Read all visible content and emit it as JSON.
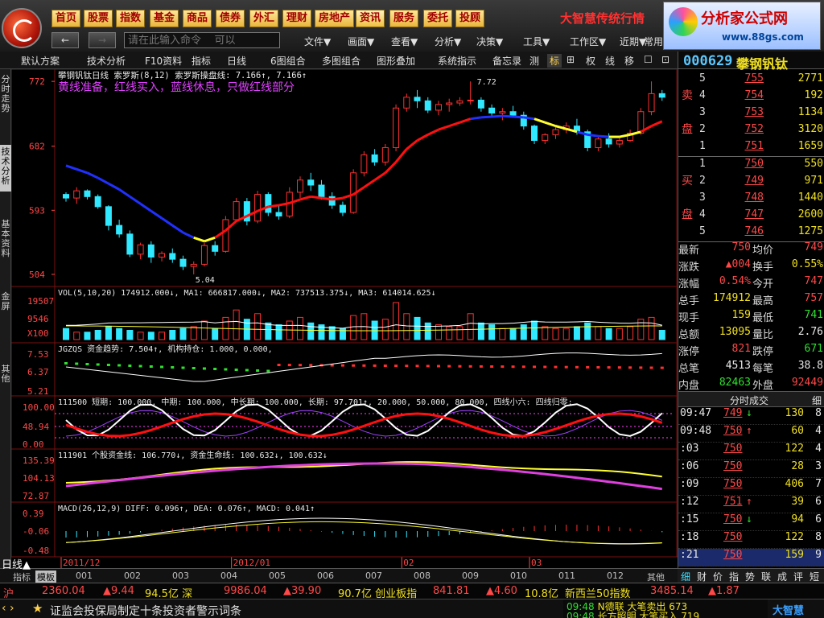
{
  "app": {
    "window_title": "大智慧",
    "menus": [
      "首页",
      "股票",
      "指数",
      "基金",
      "商品",
      "债券",
      "外汇",
      "理财",
      "房地产",
      "资讯",
      "服务",
      "委托",
      "投顾"
    ],
    "active_menu": "资讯",
    "brand_title": "大智慧传统行情",
    "brand_name": "分析家公式网",
    "brand_url": "www.88gs.com",
    "cmd_placeholder": "请在此输入命令    可以",
    "sub_menus": [
      "文件▼",
      "画面▼",
      "查看▼",
      "分析▼",
      "决策▼",
      "工具▼",
      "工作区▼",
      "近期▼",
      "常用"
    ]
  },
  "toolbar": {
    "items": [
      "默认方案",
      "技术分析",
      "F10资料",
      "指标",
      "日线",
      "6图组合",
      "多图组合",
      "图形叠加",
      "系统指示",
      "备忘录",
      "测",
      "标",
      "⊞",
      "权",
      "线",
      "移",
      "☐",
      "⊡"
    ],
    "selected": "标"
  },
  "left_tabs": [
    {
      "label": "分时走势",
      "selected": false
    },
    {
      "label": "技术分析",
      "selected": true
    },
    {
      "label": "基本资料",
      "selected": false
    },
    {
      "label": "金屏",
      "selected": false
    },
    {
      "label": "其他",
      "selected": false
    }
  ],
  "stock": {
    "code": "000629",
    "name": "攀钢钒钛"
  },
  "chart_data": {
    "type": "candlestick",
    "period": "日线",
    "header": "攀钢钒钛日线  索罗斯(8,12)  索罗斯操盘线: 7.166↑, 7.166↑",
    "annotation": "黄线准备，红线买入，蓝线休息，只做红线部分",
    "y_ticks": [
      "772",
      "682",
      "593",
      "504"
    ],
    "high_label": "7.72",
    "low_label": "5.04",
    "x_ticks": [
      "2011/12",
      "2012/01",
      "02",
      "03"
    ],
    "candles": [
      [
        6.15,
        6.18,
        6.05,
        6.1
      ],
      [
        6.1,
        6.25,
        6.02,
        6.2
      ],
      [
        6.2,
        6.22,
        6.08,
        6.12
      ],
      [
        6.12,
        6.15,
        5.95,
        5.98
      ],
      [
        5.98,
        6.0,
        5.65,
        5.72
      ],
      [
        5.72,
        5.8,
        5.55,
        5.6
      ],
      [
        5.6,
        5.65,
        5.28,
        5.32
      ],
      [
        5.32,
        5.48,
        5.25,
        5.45
      ],
      [
        5.45,
        5.5,
        5.2,
        5.28
      ],
      [
        5.28,
        5.36,
        5.22,
        5.33
      ],
      [
        5.33,
        5.4,
        5.2,
        5.25
      ],
      [
        5.25,
        5.3,
        5.1,
        5.15
      ],
      [
        5.15,
        5.22,
        5.04,
        5.18
      ],
      [
        5.18,
        5.48,
        5.15,
        5.44
      ],
      [
        5.44,
        5.5,
        5.3,
        5.36
      ],
      [
        5.36,
        5.85,
        5.34,
        5.8
      ],
      [
        5.8,
        6.1,
        5.78,
        6.05
      ],
      [
        6.05,
        6.1,
        5.72,
        5.78
      ],
      [
        5.78,
        6.2,
        5.75,
        6.15
      ],
      [
        6.15,
        6.18,
        5.85,
        5.9
      ],
      [
        5.9,
        6.0,
        5.8,
        5.85
      ],
      [
        5.85,
        6.25,
        5.82,
        6.18
      ],
      [
        6.18,
        6.4,
        6.1,
        6.35
      ],
      [
        6.35,
        6.45,
        6.2,
        6.28
      ],
      [
        6.28,
        6.35,
        6.08,
        6.12
      ],
      [
        6.12,
        6.18,
        5.95,
        6.0
      ],
      [
        6.0,
        6.05,
        5.85,
        5.9
      ],
      [
        5.9,
        6.5,
        5.88,
        6.45
      ],
      [
        6.45,
        6.75,
        6.4,
        6.7
      ],
      [
        6.7,
        6.78,
        6.55,
        6.6
      ],
      [
        6.6,
        6.85,
        6.55,
        6.8
      ],
      [
        6.8,
        7.4,
        6.75,
        7.35
      ],
      [
        7.35,
        7.55,
        7.3,
        7.5
      ],
      [
        7.5,
        7.6,
        7.35,
        7.45
      ],
      [
        7.45,
        7.5,
        7.28,
        7.32
      ],
      [
        7.32,
        7.45,
        7.25,
        7.4
      ],
      [
        7.4,
        7.48,
        7.3,
        7.42
      ],
      [
        7.42,
        7.5,
        7.38,
        7.45
      ],
      [
        7.45,
        7.72,
        7.4,
        7.46
      ],
      [
        7.46,
        7.5,
        7.3,
        7.35
      ],
      [
        7.35,
        7.4,
        7.22,
        7.28
      ],
      [
        7.28,
        7.35,
        7.18,
        7.3
      ],
      [
        7.3,
        7.38,
        7.22,
        7.25
      ],
      [
        7.25,
        7.3,
        7.05,
        7.1
      ],
      [
        7.1,
        7.12,
        6.85,
        6.9
      ],
      [
        6.9,
        7.0,
        6.85,
        6.98
      ],
      [
        6.98,
        7.1,
        6.92,
        7.05
      ],
      [
        7.05,
        7.15,
        7.0,
        7.1
      ],
      [
        7.1,
        7.2,
        6.98,
        7.02
      ],
      [
        7.02,
        7.05,
        6.75,
        6.8
      ],
      [
        6.8,
        6.95,
        6.75,
        6.92
      ],
      [
        6.92,
        7.0,
        6.8,
        6.85
      ],
      [
        6.85,
        6.95,
        6.8,
        6.9
      ],
      [
        6.9,
        7.05,
        6.88,
        7.0
      ],
      [
        7.0,
        7.35,
        6.98,
        7.3
      ],
      [
        7.3,
        7.72,
        7.25,
        7.55
      ],
      [
        7.55,
        7.6,
        7.45,
        7.5
      ]
    ],
    "soros_line": [
      6.55,
      6.5,
      6.45,
      6.38,
      6.3,
      6.22,
      6.12,
      6.02,
      5.92,
      5.82,
      5.72,
      5.62,
      5.55,
      5.5,
      5.55,
      5.65,
      5.78,
      5.85,
      5.92,
      5.98,
      6.0,
      6.03,
      6.08,
      6.12,
      6.1,
      6.08,
      6.1,
      6.15,
      6.25,
      6.35,
      6.45,
      6.6,
      6.78,
      6.9,
      6.98,
      7.05,
      7.1,
      7.15,
      7.2,
      7.22,
      7.23,
      7.24,
      7.23,
      7.22,
      7.2,
      7.15,
      7.1,
      7.06,
      7.02,
      6.98,
      6.96,
      6.95,
      6.95,
      6.98,
      7.02,
      7.1,
      7.166
    ],
    "soros_color": [
      "b",
      "b",
      "b",
      "b",
      "b",
      "b",
      "b",
      "b",
      "b",
      "b",
      "b",
      "b",
      "b",
      "y",
      "y",
      "r",
      "r",
      "r",
      "r",
      "r",
      "r",
      "r",
      "r",
      "r",
      "r",
      "r",
      "r",
      "r",
      "r",
      "r",
      "r",
      "r",
      "r",
      "r",
      "r",
      "r",
      "r",
      "r",
      "r",
      "b",
      "b",
      "b",
      "b",
      "b",
      "b",
      "y",
      "y",
      "y",
      "y",
      "b",
      "b",
      "b",
      "y",
      "y",
      "y",
      "r",
      "r"
    ],
    "volume": {
      "header": "VOL(5,10,20)  174912.000↓, MA1: 666817.000↓, MA2: 737513.375↓, MA3: 614014.625↓",
      "y_ticks": [
        "19507",
        "9546",
        "X100"
      ]
    },
    "jgzqs": {
      "header": "JGZQS  资金趋势: 7.504↑, 机构持仓: 1.000, 0.000,",
      "y_ticks": [
        "7.53",
        "6.37",
        "5.21"
      ]
    },
    "ind111500": {
      "header": "111500  短期: 100.000, 中期: 100.000, 中长期: 100.000, 长期: 97.701↑, 20.000, 50.000, 80.000, 四线小六: 四线归零:",
      "y_ticks": [
        "100.00",
        "48.94",
        "0.00"
      ]
    },
    "ind111901": {
      "header": "111901  个股资金线: 106.770↓, 资金生命线: 100.632↓, 100.632↓",
      "y_ticks": [
        "135.39",
        "104.13",
        "72.87"
      ]
    },
    "macd": {
      "header": "MACD(26,12,9)  DIFF: 0.096↑, DEA: 0.076↑, MACD: 0.041↑",
      "y_ticks": [
        "0.39",
        "-0.06",
        "-0.48"
      ]
    }
  },
  "quote": {
    "sell": [
      {
        "lv": "5",
        "price": "755",
        "vol": "2771"
      },
      {
        "lv": "4",
        "price": "754",
        "vol": "192"
      },
      {
        "lv": "3",
        "price": "753",
        "vol": "1134"
      },
      {
        "lv": "2",
        "price": "752",
        "vol": "3120"
      },
      {
        "lv": "1",
        "price": "751",
        "vol": "1659"
      }
    ],
    "buy": [
      {
        "lv": "1",
        "price": "750",
        "vol": "550"
      },
      {
        "lv": "2",
        "price": "749",
        "vol": "971"
      },
      {
        "lv": "3",
        "price": "748",
        "vol": "1440"
      },
      {
        "lv": "4",
        "price": "747",
        "vol": "2600"
      },
      {
        "lv": "5",
        "price": "746",
        "vol": "1275"
      }
    ],
    "sell_label": [
      "卖",
      "盘"
    ],
    "buy_label": [
      "买",
      "盘"
    ],
    "stats": [
      {
        "l1": "最新",
        "v1": "750",
        "c1": "red",
        "l2": "均价",
        "v2": "749",
        "c2": "red"
      },
      {
        "l1": "涨跌",
        "v1": "▲004",
        "c1": "red",
        "l2": "换手",
        "v2": "0.55%",
        "c2": "yel"
      },
      {
        "l1": "涨幅",
        "v1": "0.54%",
        "c1": "red",
        "l2": "今开",
        "v2": "747",
        "c2": "red"
      },
      {
        "l1": "总手",
        "v1": "174912",
        "c1": "yel",
        "l2": "最高",
        "v2": "757",
        "c2": "red"
      },
      {
        "l1": "现手",
        "v1": "159",
        "c1": "yel",
        "l2": "最低",
        "v2": "741",
        "c2": "grn"
      },
      {
        "l1": "总额",
        "v1": "13095",
        "c1": "yel",
        "l2": "量比",
        "v2": "2.76",
        "c2": "wht"
      },
      {
        "l1": "涨停",
        "v1": "821",
        "c1": "red",
        "l2": "跌停",
        "v2": "671",
        "c2": "grn"
      },
      {
        "l1": "总笔",
        "v1": "4513",
        "c1": "wht",
        "l2": "每笔",
        "v2": "38.8",
        "c2": "wht"
      },
      {
        "l1": "内盘",
        "v1": "82463",
        "c1": "grn",
        "l2": "外盘",
        "v2": "92449",
        "c2": "red"
      }
    ],
    "ticks_title": "分时成交",
    "ticks_detail_btn": "细",
    "ticks": [
      {
        "t": "09:47",
        "p": "749",
        "d": "↓",
        "v": "130",
        "n": "8"
      },
      {
        "t": "09:48",
        "p": "750",
        "d": "↑",
        "v": "60",
        "n": "4"
      },
      {
        "t": ":03",
        "p": "750",
        "d": "",
        "v": "122",
        "n": "4"
      },
      {
        "t": ":06",
        "p": "750",
        "d": "",
        "v": "28",
        "n": "3"
      },
      {
        "t": ":09",
        "p": "750",
        "d": "",
        "v": "406",
        "n": "7"
      },
      {
        "t": ":12",
        "p": "751",
        "d": "↑",
        "v": "39",
        "n": "6"
      },
      {
        "t": ":15",
        "p": "750",
        "d": "↓",
        "v": "94",
        "n": "6"
      },
      {
        "t": ":18",
        "p": "750",
        "d": "",
        "v": "122",
        "n": "8"
      },
      {
        "t": ":21",
        "p": "750",
        "d": "",
        "v": "159",
        "n": "9"
      }
    ],
    "tabs": [
      "细",
      "财",
      "价",
      "指",
      "势",
      "联",
      "成",
      "评",
      "短"
    ]
  },
  "bottom_tabs": [
    "日线▲",
    "指标",
    "模板",
    "001",
    "002",
    "003",
    "004",
    "005",
    "006",
    "007",
    "008",
    "009",
    "010",
    "011",
    "012",
    "其他"
  ],
  "bottom_selected": "模板",
  "index_ticker": [
    {
      "t": "沪",
      "c": "red"
    },
    {
      "t": "2360.04",
      "c": "red"
    },
    {
      "t": "▲9.44",
      "c": "red"
    },
    {
      "t": "94.5亿 深",
      "c": "yel"
    },
    {
      "t": "9986.04",
      "c": "red"
    },
    {
      "t": "▲39.90",
      "c": "red"
    },
    {
      "t": "90.7亿 创业板指",
      "c": "yel"
    },
    {
      "t": "841.81",
      "c": "red"
    },
    {
      "t": "▲4.60",
      "c": "red"
    },
    {
      "t": "10.8亿",
      "c": "yel"
    },
    {
      "t": "新西兰50指数",
      "c": "yel"
    },
    {
      "t": "3485.14",
      "c": "red"
    },
    {
      "t": "▲1.87",
      "c": "red"
    }
  ],
  "news": "证监会投保局制定十条投资者警示词条",
  "alerts": [
    {
      "time": "09:48",
      "text": "N德联   大笔卖出 673"
    },
    {
      "time": "09:48",
      "text": "长方照明 大笔买入 719"
    }
  ],
  "status_logo": "大智慧"
}
